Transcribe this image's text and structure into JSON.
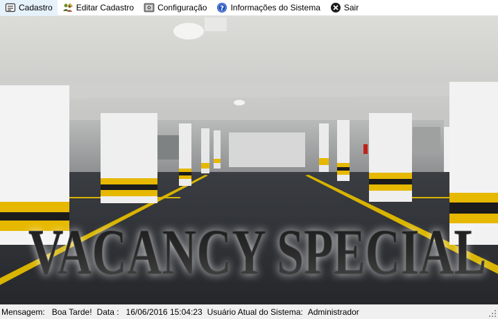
{
  "menu": {
    "items": [
      {
        "label": "Cadastro",
        "icon": "form-icon"
      },
      {
        "label": "Editar Cadastro",
        "icon": "edit-users-icon"
      },
      {
        "label": "Configuração",
        "icon": "settings-icon"
      },
      {
        "label": "Informações do Sistema",
        "icon": "help-icon"
      },
      {
        "label": "Sair",
        "icon": "exit-icon"
      }
    ]
  },
  "banner": {
    "title": "VACANCY SPECIAL",
    "description_colors": {
      "pillar_stripe": "#e6b800",
      "floor": "#2b2e33",
      "ceiling": "#d9d9d6"
    }
  },
  "status": {
    "message_label": "Mensagem:",
    "message_value": "Boa Tarde!",
    "date_label": "Data :",
    "date_value": "16/06/2016 15:04:23",
    "user_label": "Usuário Atual do Sistema:",
    "user_value": "Administrador"
  }
}
